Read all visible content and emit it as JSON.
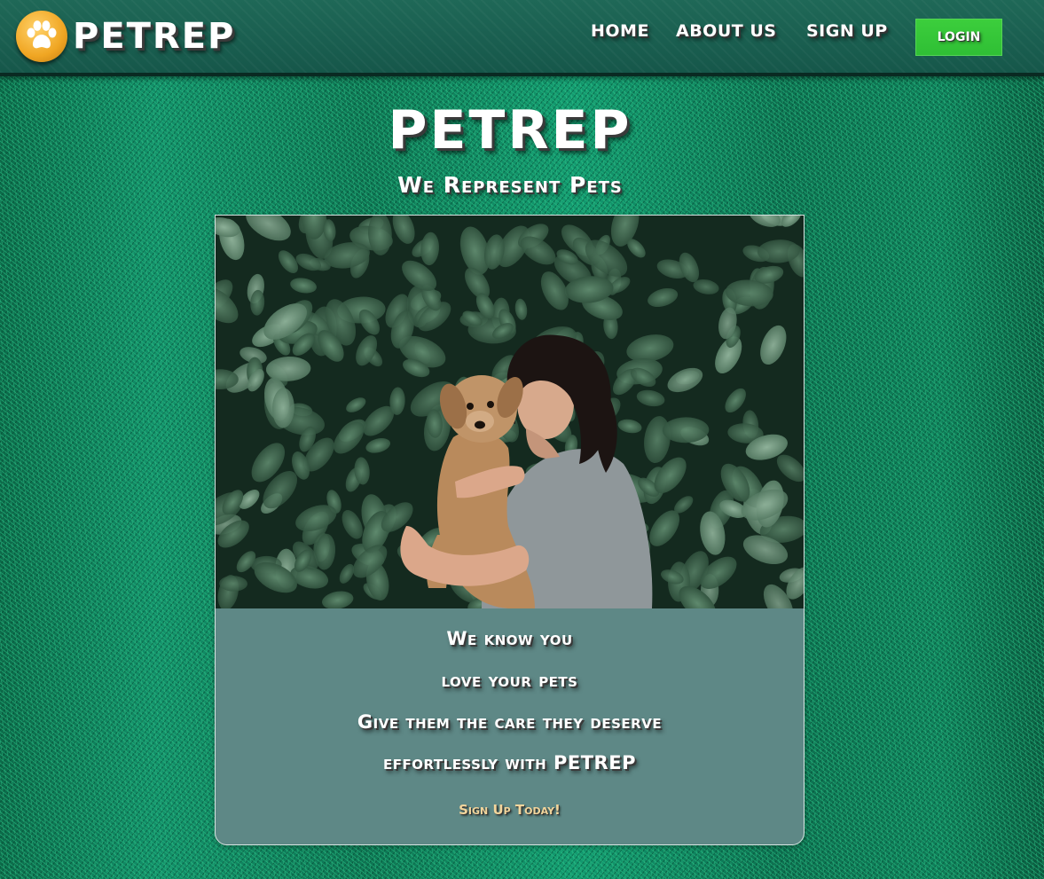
{
  "header": {
    "brand": "PETREP",
    "nav": {
      "home": "HOME",
      "about": "ABOUT US",
      "signup": "SIGN UP",
      "login": "Login"
    },
    "colors": {
      "bar": "#1b5e4f",
      "login": "#34c53a",
      "logo": "#f0a623"
    }
  },
  "hero": {
    "title": "PETREP",
    "subtitle": "We Represent Pets"
  },
  "card": {
    "image": "photo of a woman holding a small dog in front of green ivy leaves",
    "lines": [
      "We know you",
      "love your pets",
      "Give them the care they deserve",
      "effortlessly with PETREP"
    ],
    "cta": "Sign Up Today!",
    "colors": {
      "panel": "#5e8886",
      "cta": "#f1d59c"
    }
  },
  "icons": {
    "logo": "paw-icon"
  }
}
